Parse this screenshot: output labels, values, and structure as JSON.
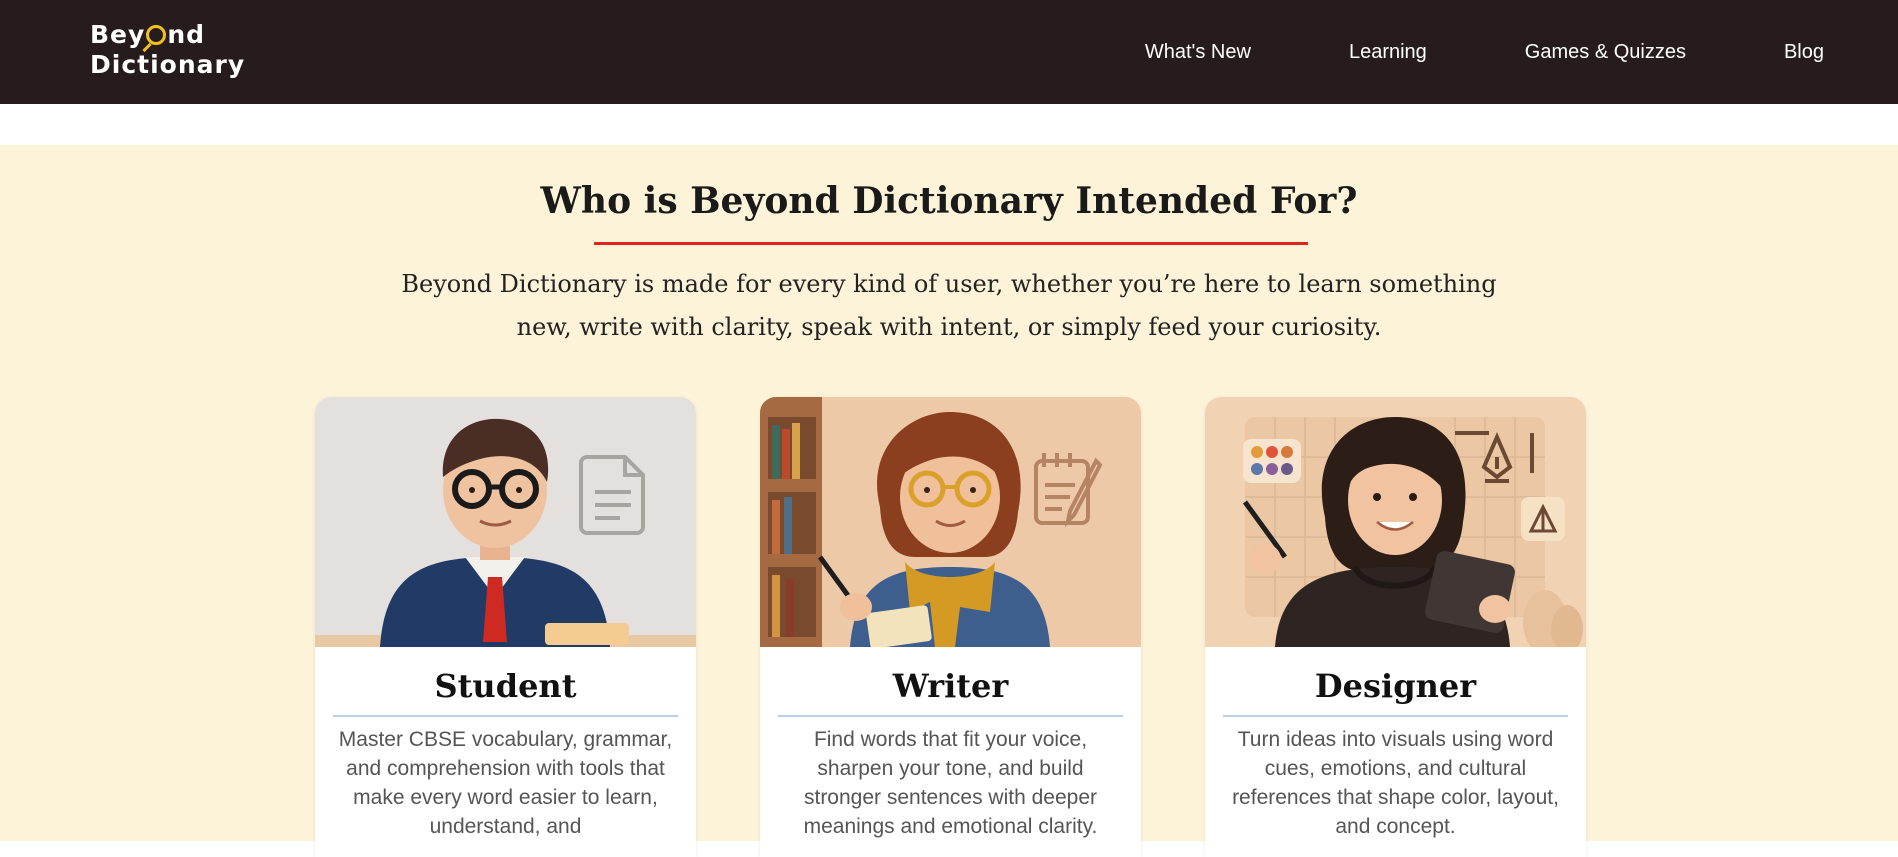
{
  "header": {
    "logo_line1_a": "Bey",
    "logo_line1_b": "nd",
    "logo_line2": "Dictionary",
    "nav": [
      "What's New",
      "Learning",
      "Games & Quizzes",
      "Blog"
    ]
  },
  "section": {
    "title": "Who is Beyond Dictionary Intended For?",
    "intro": "Beyond Dictionary is made for every kind of user, whether you’re here to learn something new, write with clarity, speak with intent, or simply feed your curiosity."
  },
  "cards": [
    {
      "title": "Student",
      "text": "Master CBSE vocabulary, grammar, and comprehension with tools that make every word easier to learn, understand, and"
    },
    {
      "title": "Writer",
      "text": "Find words that fit your voice, sharpen your tone, and build stronger sentences with deeper meanings and emotional clarity."
    },
    {
      "title": "Designer",
      "text": "Turn ideas into visuals using word cues, emotions, and cultural references that shape color, layout, and concept."
    }
  ],
  "colors": {
    "header_bg": "#271c1d",
    "section_bg": "#fdf3d9",
    "accent_underline": "#e0231c",
    "logo_accent": "#f2c21b"
  }
}
